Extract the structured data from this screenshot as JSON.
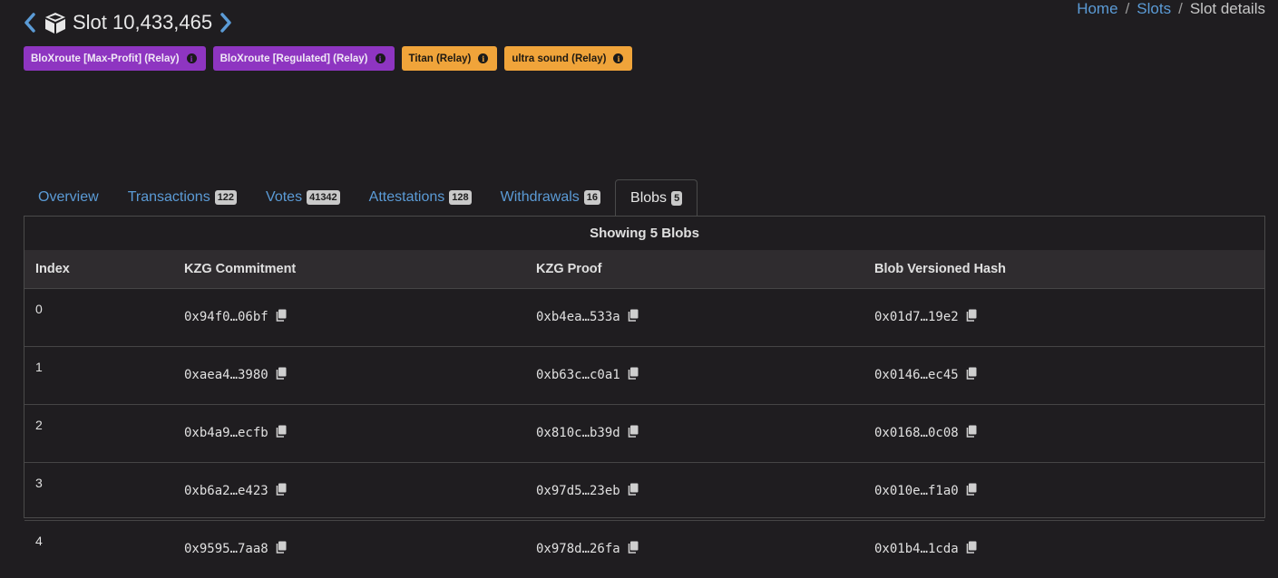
{
  "header": {
    "title": "Slot 10,433,465",
    "prev_icon": "chevron-left-icon",
    "next_icon": "chevron-right-icon",
    "cube_icon": "cube-icon"
  },
  "breadcrumb": {
    "home": "Home",
    "sep1": "/",
    "slots": "Slots",
    "sep2": "/",
    "current": "Slot details"
  },
  "relays": [
    {
      "label": "BloXroute [Max-Profit] (Relay)",
      "color": "#8e35c1"
    },
    {
      "label": "BloXroute [Regulated] (Relay)",
      "color": "#8e35c1"
    },
    {
      "label": "Titan (Relay)",
      "color": "#f0a43a"
    },
    {
      "label": "ultra sound (Relay)",
      "color": "#f0a43a"
    }
  ],
  "tabs": [
    {
      "label": "Overview",
      "count": ""
    },
    {
      "label": "Transactions",
      "count": "122"
    },
    {
      "label": "Votes",
      "count": "41342"
    },
    {
      "label": "Attestations",
      "count": "128"
    },
    {
      "label": "Withdrawals",
      "count": "16"
    },
    {
      "label": "Blobs",
      "count": "5"
    }
  ],
  "blobs": {
    "caption": "Showing 5 Blobs",
    "columns": [
      "Index",
      "KZG Commitment",
      "KZG Proof",
      "Blob Versioned Hash"
    ],
    "rows": [
      {
        "index": "0",
        "commitment": "0x94f0…06bf",
        "proof": "0xb4ea…533a",
        "hash": "0x01d7…19e2"
      },
      {
        "index": "1",
        "commitment": "0xaea4…3980",
        "proof": "0xb63c…c0a1",
        "hash": "0x0146…ec45"
      },
      {
        "index": "2",
        "commitment": "0xb4a9…ecfb",
        "proof": "0x810c…b39d",
        "hash": "0x0168…0c08"
      },
      {
        "index": "3",
        "commitment": "0xb6a2…e423",
        "proof": "0x97d5…23eb",
        "hash": "0x010e…f1a0"
      },
      {
        "index": "4",
        "commitment": "0x9595…7aa8",
        "proof": "0x978d…26fa",
        "hash": "0x01b4…1cda"
      }
    ]
  },
  "colors": {
    "link": "#5b9bd6",
    "background": "#1f1d20",
    "relay_purple": "#8e35c1",
    "relay_orange": "#f0a43a"
  }
}
